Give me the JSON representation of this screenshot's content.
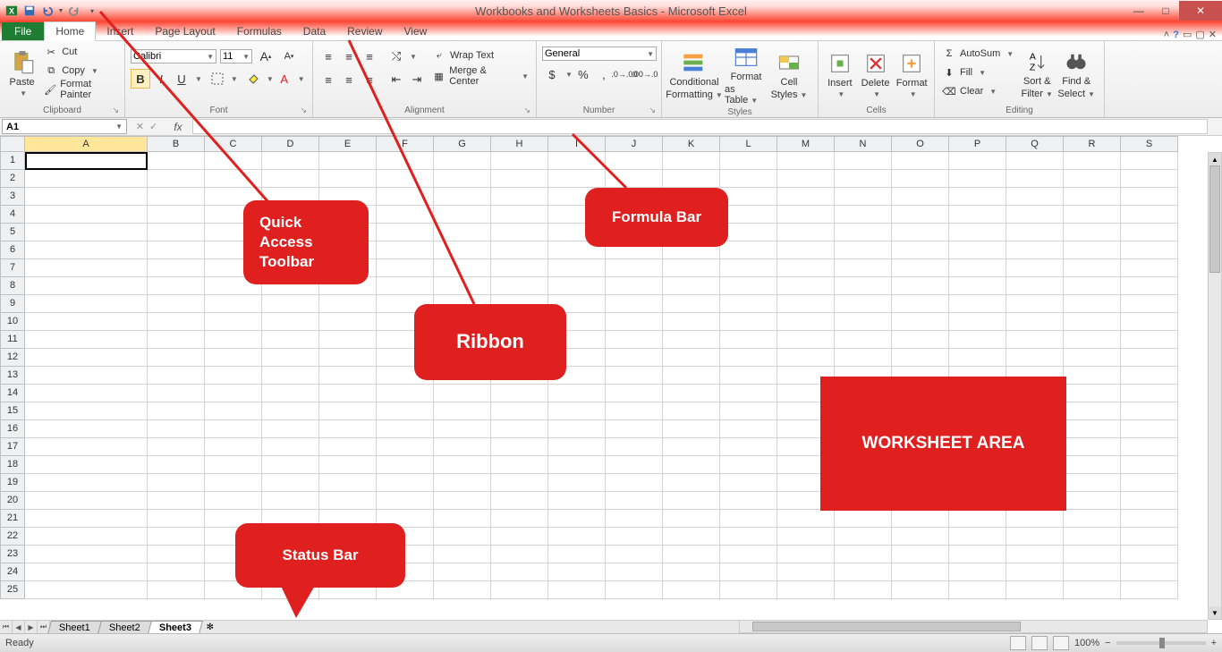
{
  "title": "Workbooks and Worksheets Basics - Microsoft Excel",
  "qat": {
    "icons": [
      "excel",
      "save",
      "undo",
      "redo",
      "customize"
    ]
  },
  "window_controls": {
    "min": "minimize",
    "max": "restore",
    "close": "close"
  },
  "tabs": {
    "file": "File",
    "items": [
      "Home",
      "Insert",
      "Page Layout",
      "Formulas",
      "Data",
      "Review",
      "View"
    ],
    "active": "Home"
  },
  "help_icons": [
    "minimize-ribbon",
    "help"
  ],
  "ribbon": {
    "clipboard": {
      "label": "Clipboard",
      "paste": "Paste",
      "cut": "Cut",
      "copy": "Copy",
      "format_painter": "Format Painter"
    },
    "font": {
      "label": "Font",
      "name": "Calibri",
      "size": "11",
      "grow": "A",
      "shrink": "A",
      "bold": "B",
      "italic": "I",
      "underline": "U"
    },
    "alignment": {
      "label": "Alignment",
      "wrap": "Wrap Text",
      "merge": "Merge & Center"
    },
    "number": {
      "label": "Number",
      "format": "General",
      "currency": "$",
      "percent": "%",
      "comma": ","
    },
    "styles": {
      "label": "Styles",
      "cond": "Conditional Formatting",
      "cond1": "Conditional",
      "cond2": "Formatting",
      "ftable1": "Format",
      "ftable2": "as Table",
      "cell1": "Cell",
      "cell2": "Styles"
    },
    "cells": {
      "label": "Cells",
      "insert": "Insert",
      "delete": "Delete",
      "format": "Format"
    },
    "editing": {
      "label": "Editing",
      "autosum": "AutoSum",
      "fill": "Fill",
      "clear": "Clear",
      "sort1": "Sort &",
      "sort2": "Filter",
      "find1": "Find &",
      "find2": "Select"
    }
  },
  "namebox": "A1",
  "fx": "fx",
  "columns": [
    "A",
    "B",
    "C",
    "D",
    "E",
    "F",
    "G",
    "H",
    "I",
    "J",
    "K",
    "L",
    "M",
    "N",
    "O",
    "P",
    "Q",
    "R",
    "S"
  ],
  "rows": [
    "1",
    "2",
    "3",
    "4",
    "5",
    "6",
    "7",
    "8",
    "9",
    "10",
    "11",
    "12",
    "13",
    "14",
    "15",
    "16",
    "17",
    "18",
    "19",
    "20",
    "21",
    "22",
    "23",
    "24",
    "25"
  ],
  "sheets": {
    "items": [
      "Sheet1",
      "Sheet2",
      "Sheet3"
    ],
    "active": "Sheet3"
  },
  "status": {
    "ready": "Ready",
    "zoom": "100%"
  },
  "callouts": {
    "qat": "Quick Access Toolbar",
    "qat_l1": "Quick",
    "qat_l2": "Access",
    "qat_l3": "Toolbar",
    "ribbon": "Ribbon",
    "formula": "Formula Bar",
    "status": "Status Bar",
    "worksheet": "WORKSHEET AREA"
  }
}
